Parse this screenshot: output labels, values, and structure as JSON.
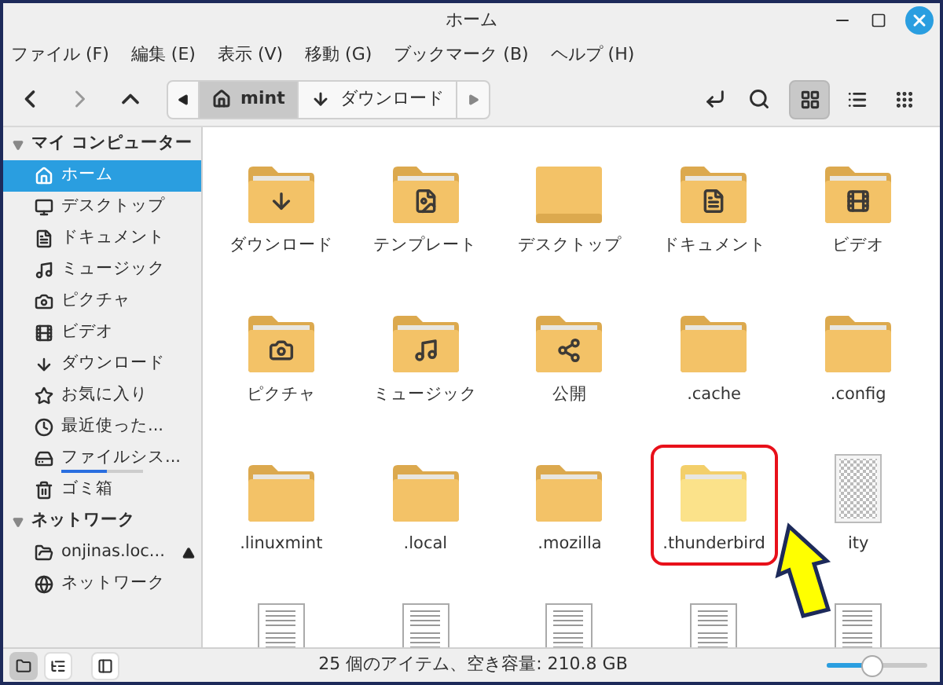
{
  "window": {
    "title": "ホーム"
  },
  "menu": [
    "ファイル (F)",
    "編集 (E)",
    "表示 (V)",
    "移動 (G)",
    "ブックマーク (B)",
    "ヘルプ (H)"
  ],
  "breadcrumb": [
    {
      "label": "mint",
      "kind": "home",
      "selected": true
    },
    {
      "label": "ダウンロード",
      "kind": "download",
      "selected": false
    }
  ],
  "view_buttons": [
    {
      "kind": "grid",
      "selected": true
    },
    {
      "kind": "list",
      "selected": false
    },
    {
      "kind": "compact",
      "selected": false
    }
  ],
  "sidebar": [
    {
      "label": "マイ コンピューター",
      "expanded": true,
      "children": [
        {
          "label": "ホーム",
          "kind": "home",
          "selected": true
        },
        {
          "label": "デスクトップ",
          "kind": "desktop",
          "selected": false
        },
        {
          "label": "ドキュメント",
          "kind": "document",
          "selected": false
        },
        {
          "label": "ミュージック",
          "kind": "music",
          "selected": false
        },
        {
          "label": "ピクチャ",
          "kind": "camera",
          "selected": false
        },
        {
          "label": "ビデオ",
          "kind": "film",
          "selected": false
        },
        {
          "label": "ダウンロード",
          "kind": "download",
          "selected": false
        },
        {
          "label": "お気に入り",
          "kind": "star",
          "selected": false
        },
        {
          "label": "最近使った...",
          "kind": "clock",
          "selected": false
        },
        {
          "label": "ファイルシス...",
          "kind": "disk",
          "selected": false,
          "level": 0.55
        },
        {
          "label": "ゴミ箱",
          "kind": "trash",
          "selected": false
        }
      ]
    },
    {
      "label": "ネットワーク",
      "expanded": true,
      "children": [
        {
          "label": "onjinas.loc...",
          "kind": "share",
          "selected": false,
          "eject": true
        },
        {
          "label": "ネットワーク",
          "kind": "globe",
          "selected": false
        }
      ]
    }
  ],
  "files": [
    {
      "label": "ダウンロード",
      "kind": "download",
      "highlighted": false
    },
    {
      "label": "テンプレート",
      "kind": "template",
      "highlighted": false
    },
    {
      "label": "デスクトップ",
      "kind": "desktop",
      "highlighted": false
    },
    {
      "label": "ドキュメント",
      "kind": "document",
      "highlighted": false
    },
    {
      "label": "ビデオ",
      "kind": "film",
      "highlighted": false
    },
    {
      "label": "ピクチャ",
      "kind": "camera",
      "highlighted": false
    },
    {
      "label": "ミュージック",
      "kind": "music",
      "highlighted": false
    },
    {
      "label": "公開",
      "kind": "share",
      "highlighted": false
    },
    {
      "label": ".cache",
      "kind": "folder",
      "highlighted": false
    },
    {
      "label": ".config",
      "kind": "folder",
      "highlighted": false
    },
    {
      "label": ".linuxmint",
      "kind": "folder",
      "highlighted": false
    },
    {
      "label": ".local",
      "kind": "folder",
      "highlighted": false
    },
    {
      "label": ".mozilla",
      "kind": "folder",
      "highlighted": false
    },
    {
      "label": ".thunderbird",
      "kind": "folder",
      "highlighted": true
    },
    {
      "label": "ity",
      "kind": "image",
      "highlighted": false
    },
    {
      "kind": "text",
      "highlighted": false
    },
    {
      "kind": "text",
      "highlighted": false
    },
    {
      "kind": "text",
      "highlighted": false
    },
    {
      "kind": "text",
      "highlighted": false
    },
    {
      "kind": "text",
      "highlighted": false
    }
  ],
  "status_bar": {
    "panes": [
      {
        "kind": "places",
        "selected": true
      },
      {
        "kind": "tree",
        "selected": false
      },
      {
        "kind": "hide",
        "selected": false
      }
    ],
    "text": "25 個のアイテム、空き容量: 210.8 GB",
    "zoom": {
      "level": 0.45
    }
  }
}
